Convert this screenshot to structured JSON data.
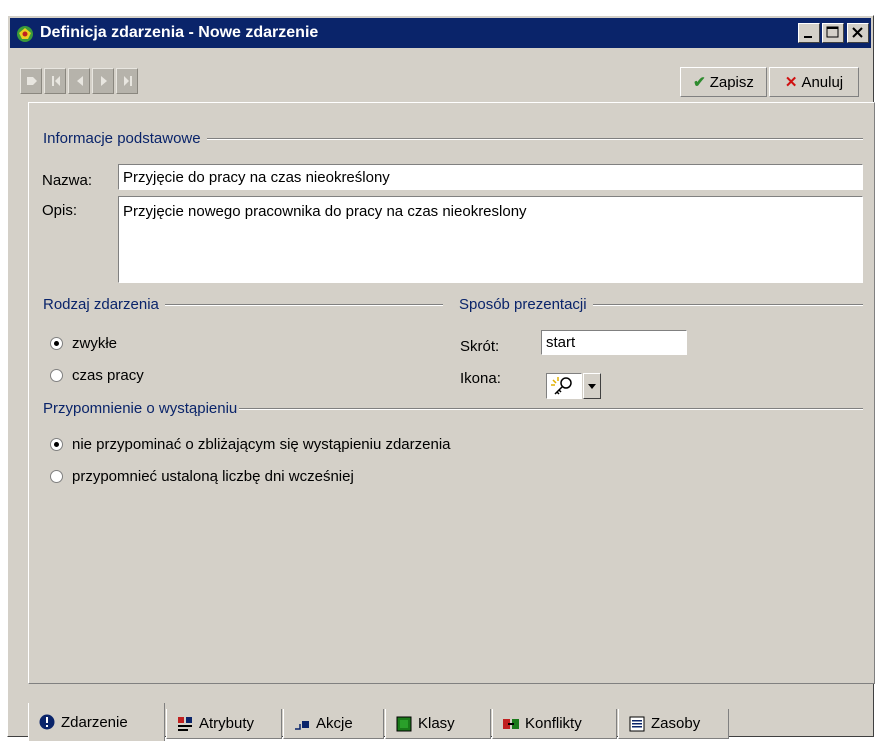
{
  "window": {
    "title": "Definicja zdarzenia - Nowe zdarzenie",
    "minimize_label": "_",
    "maximize_label": "□",
    "close_label": "X"
  },
  "toolbar": {
    "save_label": "Zapisz",
    "cancel_label": "Anuluj",
    "save_icon": "✔",
    "cancel_icon": "✕"
  },
  "basic": {
    "heading": "Informacje podstawowe",
    "name_label": "Nazwa:",
    "name_value": "Przyjęcie do pracy na czas nieokreślony",
    "desc_label": "Opis:",
    "desc_value": "Przyjęcie nowego pracownika do pracy na czas nieokreslony"
  },
  "event_type": {
    "heading": "Rodzaj zdarzenia",
    "options": [
      {
        "label": "zwykłe",
        "selected": true
      },
      {
        "label": "czas pracy",
        "selected": false
      }
    ]
  },
  "presentation": {
    "heading": "Sposób prezentacji",
    "shortcut_label": "Skrót:",
    "shortcut_value": "start",
    "icon_label": "Ikona:"
  },
  "reminder": {
    "heading": "Przypomnienie o wystąpieniu",
    "options": [
      {
        "label": "nie przypominać o zbliżającym się wystąpieniu zdarzenia",
        "selected": true
      },
      {
        "label": "przypomnieć ustaloną liczbę dni wcześniej",
        "selected": false
      }
    ]
  },
  "tabs": [
    {
      "label": "Zdarzenie",
      "icon": "info-icon",
      "active": true
    },
    {
      "label": "Atrybuty",
      "icon": "attributes-icon",
      "active": false
    },
    {
      "label": "Akcje",
      "icon": "actions-icon",
      "active": false
    },
    {
      "label": "Klasy",
      "icon": "classes-icon",
      "active": false
    },
    {
      "label": "Konflikty",
      "icon": "conflicts-icon",
      "active": false
    },
    {
      "label": "Zasoby",
      "icon": "resources-icon",
      "active": false
    }
  ],
  "colors": {
    "titlebar": "#0a246a",
    "heading_text": "#0a246a",
    "face": "#d4d0c8",
    "save_check": "#2e8b2e",
    "cancel_x": "#d01010"
  }
}
